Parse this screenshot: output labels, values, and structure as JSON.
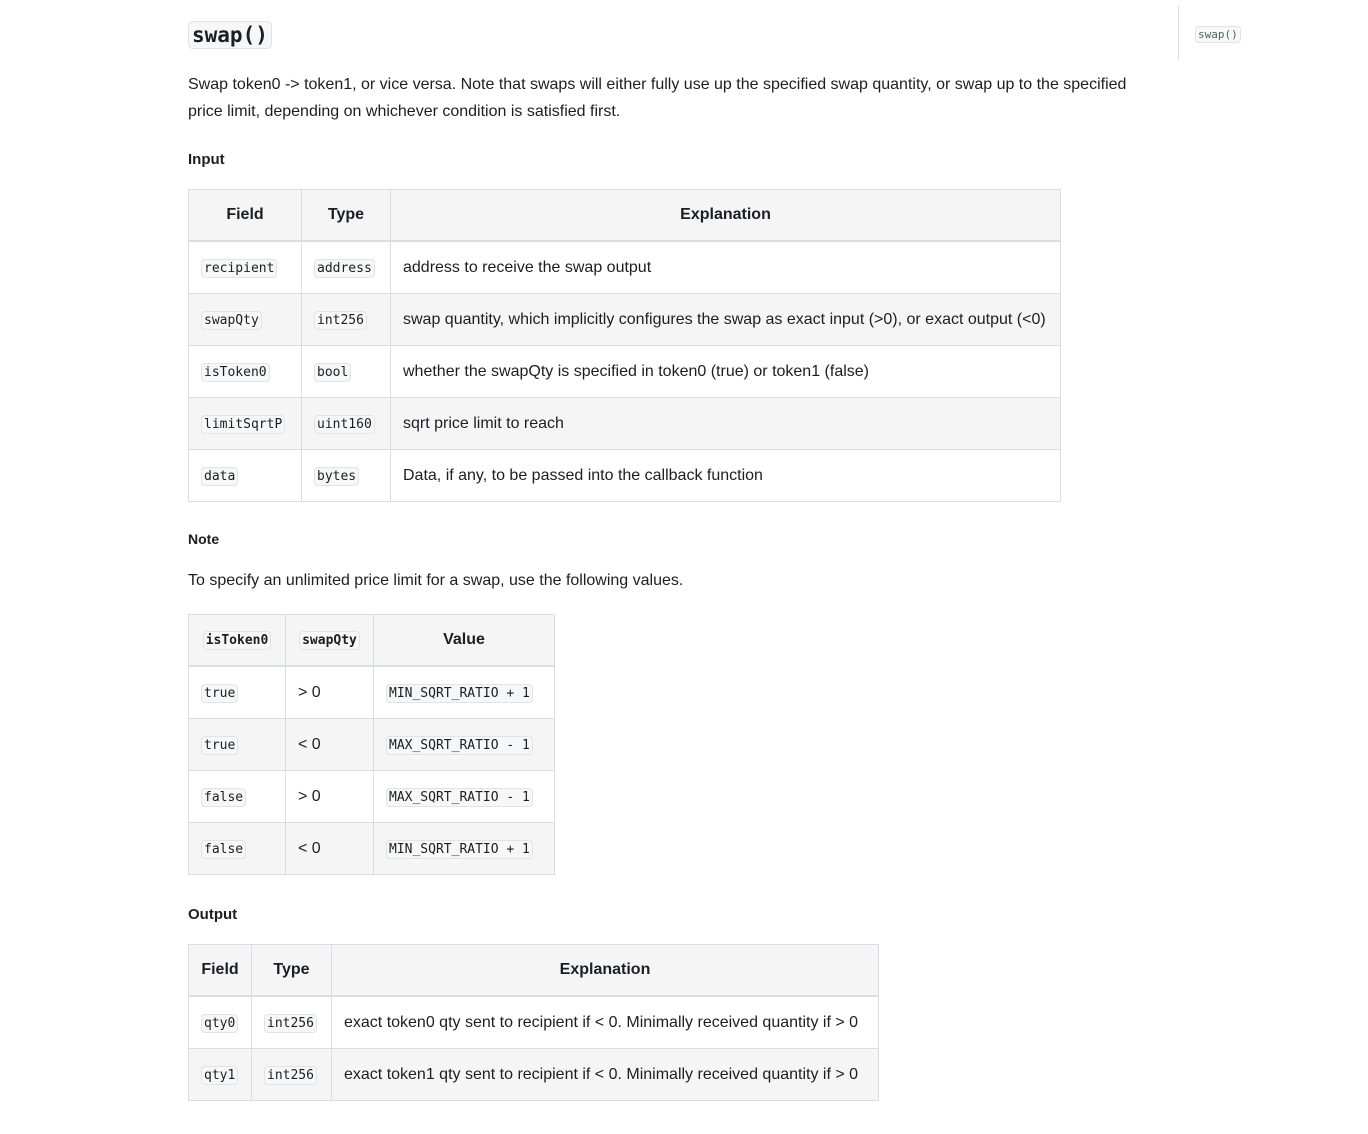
{
  "toc": {
    "link": "swap()"
  },
  "title": "swap()",
  "description": "Swap token0 -> token1, or vice versa. Note that swaps will either fully use up the specified swap quantity, or swap up to the specified price limit, depending on whichever condition is satisfied first.",
  "input": {
    "heading": "Input",
    "headers": [
      "Field",
      "Type",
      "Explanation"
    ],
    "rows": [
      {
        "field": "recipient",
        "type": "address",
        "explanation": "address to receive the swap output"
      },
      {
        "field": "swapQty",
        "type": "int256",
        "explanation": "swap quantity, which implicitly configures the swap as exact input (>0), or exact output (<0)"
      },
      {
        "field": "isToken0",
        "type": "bool",
        "explanation": "whether the swapQty is specified in token0 (true) or token1 (false)"
      },
      {
        "field": "limitSqrtP",
        "type": "uint160",
        "explanation": "sqrt price limit to reach"
      },
      {
        "field": "data",
        "type": "bytes",
        "explanation": "Data, if any, to be passed into the callback function"
      }
    ]
  },
  "note": {
    "heading": "Note",
    "text": "To specify an unlimited price limit for a swap, use the following values.",
    "headers": [
      "isToken0",
      "swapQty",
      "Value"
    ],
    "rows": [
      {
        "isToken0": "true",
        "swapQty": "> 0",
        "value": "MIN_SQRT_RATIO + 1"
      },
      {
        "isToken0": "true",
        "swapQty": "< 0",
        "value": "MAX_SQRT_RATIO - 1"
      },
      {
        "isToken0": "false",
        "swapQty": "> 0",
        "value": "MAX_SQRT_RATIO - 1"
      },
      {
        "isToken0": "false",
        "swapQty": "< 0",
        "value": "MIN_SQRT_RATIO + 1"
      }
    ]
  },
  "output": {
    "heading": "Output",
    "headers": [
      "Field",
      "Type",
      "Explanation"
    ],
    "rows": [
      {
        "field": "qty0",
        "type": "int256",
        "explanation": "exact token0 qty sent to recipient if < 0. Minimally received quantity if > 0"
      },
      {
        "field": "qty1",
        "type": "int256",
        "explanation": "exact token1 qty sent to recipient if < 0. Minimally received quantity if > 0"
      }
    ]
  }
}
